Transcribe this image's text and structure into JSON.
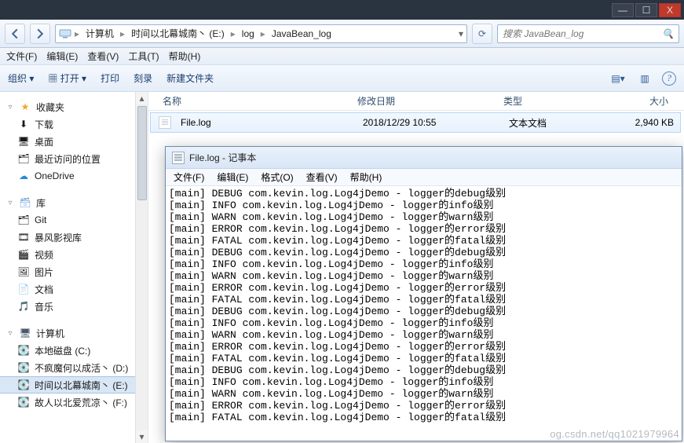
{
  "window": {
    "minimize": "—",
    "maximize": "☐",
    "close": "X",
    "tab_hints": [
      "",
      "",
      "",
      "",
      "",
      ""
    ]
  },
  "nav": {
    "back": "",
    "fwd": "",
    "crumbs": [
      "计算机",
      "时间以北幕城南丶 (E:)",
      "log",
      "JavaBean_log"
    ],
    "refresh": "⟳"
  },
  "search": {
    "placeholder": "搜索 JavaBean_log",
    "icon": "🔍"
  },
  "menu": {
    "file": "文件(F)",
    "edit": "编辑(E)",
    "view": "查看(V)",
    "tools": "工具(T)",
    "help": "帮助(H)"
  },
  "toolbar": {
    "organize": "组织 ▾",
    "open": "打开 ▾",
    "print": "打印",
    "burn": "刻录",
    "newfolder": "新建文件夹",
    "view_icon": "▤",
    "preview_icon": "▥",
    "help": "?"
  },
  "navpane": {
    "favorites": {
      "label": "收藏夹",
      "items": [
        "下载",
        "桌面",
        "最近访问的位置",
        "OneDrive"
      ]
    },
    "libraries": {
      "label": "库",
      "items": [
        "Git",
        "暴风影视库",
        "视频",
        "图片",
        "文档",
        "音乐"
      ]
    },
    "computer": {
      "label": "计算机",
      "items": [
        "本地磁盘 (C:)",
        "不疯魔何以成活丶 (D:)",
        "时间以北幕城南丶 (E:)",
        "故人以北爱荒凉丶 (F:)"
      ]
    }
  },
  "columns": {
    "name": "名称",
    "date": "修改日期",
    "type": "类型",
    "size": "大小"
  },
  "files": [
    {
      "name": "File.log",
      "date": "2018/12/29 10:55",
      "type": "文本文档",
      "size": "2,940 KB"
    }
  ],
  "notepad": {
    "title": "File.log - 记事本",
    "menu": {
      "file": "文件(F)",
      "edit": "编辑(E)",
      "format": "格式(O)",
      "view": "查看(V)",
      "help": "帮助(H)"
    },
    "lines": [
      "[main] DEBUG com.kevin.log.Log4jDemo - logger的debug级别",
      "[main] INFO com.kevin.log.Log4jDemo - logger的info级别",
      "[main] WARN com.kevin.log.Log4jDemo - logger的warn级别",
      "[main] ERROR com.kevin.log.Log4jDemo - logger的error级别",
      "[main] FATAL com.kevin.log.Log4jDemo - logger的fatal级别",
      "[main] DEBUG com.kevin.log.Log4jDemo - logger的debug级别",
      "[main] INFO com.kevin.log.Log4jDemo - logger的info级别",
      "[main] WARN com.kevin.log.Log4jDemo - logger的warn级别",
      "[main] ERROR com.kevin.log.Log4jDemo - logger的error级别",
      "[main] FATAL com.kevin.log.Log4jDemo - logger的fatal级别",
      "[main] DEBUG com.kevin.log.Log4jDemo - logger的debug级别",
      "[main] INFO com.kevin.log.Log4jDemo - logger的info级别",
      "[main] WARN com.kevin.log.Log4jDemo - logger的warn级别",
      "[main] ERROR com.kevin.log.Log4jDemo - logger的error级别",
      "[main] FATAL com.kevin.log.Log4jDemo - logger的fatal级别",
      "[main] DEBUG com.kevin.log.Log4jDemo - logger的debug级别",
      "[main] INFO com.kevin.log.Log4jDemo - logger的info级别",
      "[main] WARN com.kevin.log.Log4jDemo - logger的warn级别",
      "[main] ERROR com.kevin.log.Log4jDemo - logger的error级别",
      "[main] FATAL com.kevin.log.Log4jDemo - logger的fatal级别"
    ]
  },
  "watermark": "og.csdn.net/qq1021979964"
}
